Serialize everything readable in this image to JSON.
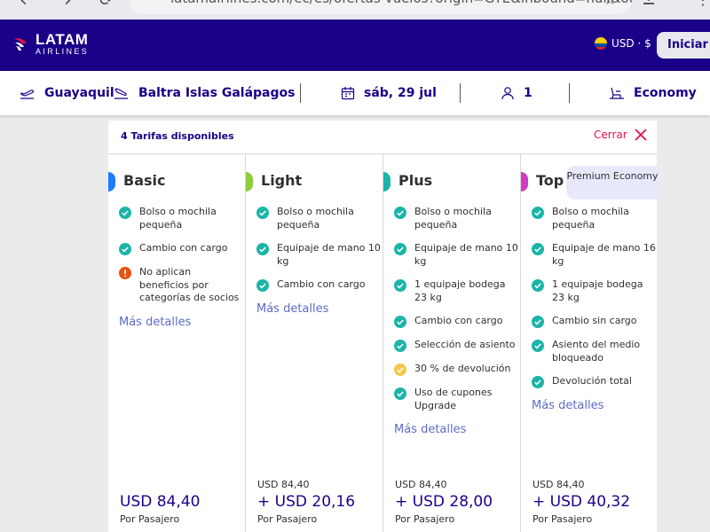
{
  "browser": {
    "url": "latamairlines.com/ec/es/ofertas-vuelos?origin=GYE&inbound=null&outbou"
  },
  "header": {
    "logo_main": "LATAM",
    "logo_sub": "AIRLINES",
    "currency": "USD · $",
    "login_label": "Iniciar s",
    "brand_color": "#1b0088",
    "accent_color": "#e8114b"
  },
  "search": {
    "origin": "Guayaquil",
    "destination": "Baltra Islas Galápagos",
    "date": "sáb, 29 jul",
    "passengers": "1",
    "cabin": "Economy"
  },
  "fares_panel": {
    "count_label": "4 Tarifas disponibles",
    "close_label": "Cerrar",
    "columns": [
      {
        "name": "Basic",
        "color": "#1d7cff",
        "badge": "",
        "benefits": [
          {
            "icon": "check-icon",
            "text": "Bolso o mochila pequeña"
          },
          {
            "icon": "check-icon",
            "text": "Cambio con cargo"
          },
          {
            "icon": "warning-icon",
            "text": "No aplican beneficios por categorías de socios"
          }
        ],
        "more_label": "Más detalles",
        "old_price": "",
        "price": "USD 84,40",
        "per_label": "Por Pasajero"
      },
      {
        "name": "Light",
        "color": "#8ecd3b",
        "badge": "",
        "benefits": [
          {
            "icon": "check-icon",
            "text": "Bolso o mochila pequeña"
          },
          {
            "icon": "check-icon",
            "text": "Equipaje de mano 10 kg"
          },
          {
            "icon": "check-icon",
            "text": "Cambio con cargo"
          }
        ],
        "more_label": "Más detalles",
        "old_price": "USD  84,40",
        "price": "+ USD 20,16",
        "per_label": "Por Pasajero"
      },
      {
        "name": "Plus",
        "color": "#1bb5a8",
        "badge": "",
        "benefits": [
          {
            "icon": "check-icon",
            "text": "Bolso o mochila pequeña"
          },
          {
            "icon": "check-icon",
            "text": "Equipaje de mano 10 kg"
          },
          {
            "icon": "check-icon",
            "text": "1 equipaje bodega 23 kg"
          },
          {
            "icon": "check-icon",
            "text": "Cambio con cargo"
          },
          {
            "icon": "check-icon",
            "text": "Selección de asiento"
          },
          {
            "icon": "partial-check-icon",
            "text": "30 % de devolución"
          },
          {
            "icon": "check-icon",
            "text": "Uso de cupones Upgrade"
          }
        ],
        "more_label": "Más detalles",
        "old_price": "USD  84,40",
        "price": "+ USD 28,00",
        "per_label": "Por Pasajero"
      },
      {
        "name": "Top",
        "color": "#d13bc2",
        "badge": "Premium Economy",
        "benefits": [
          {
            "icon": "check-icon",
            "text": "Bolso o mochila pequeña"
          },
          {
            "icon": "check-icon",
            "text": "Equipaje de mano 16 kg"
          },
          {
            "icon": "check-icon",
            "text": "1 equipaje bodega 23 kg"
          },
          {
            "icon": "check-icon",
            "text": "Cambio sin cargo"
          },
          {
            "icon": "check-icon",
            "text": "Asiento del medio bloqueado"
          },
          {
            "icon": "check-icon",
            "text": "Devolución total"
          }
        ],
        "more_label": "Más detalles",
        "old_price": "USD  84,40",
        "price": "+ USD 40,32",
        "per_label": "Por Pasajero"
      }
    ]
  }
}
